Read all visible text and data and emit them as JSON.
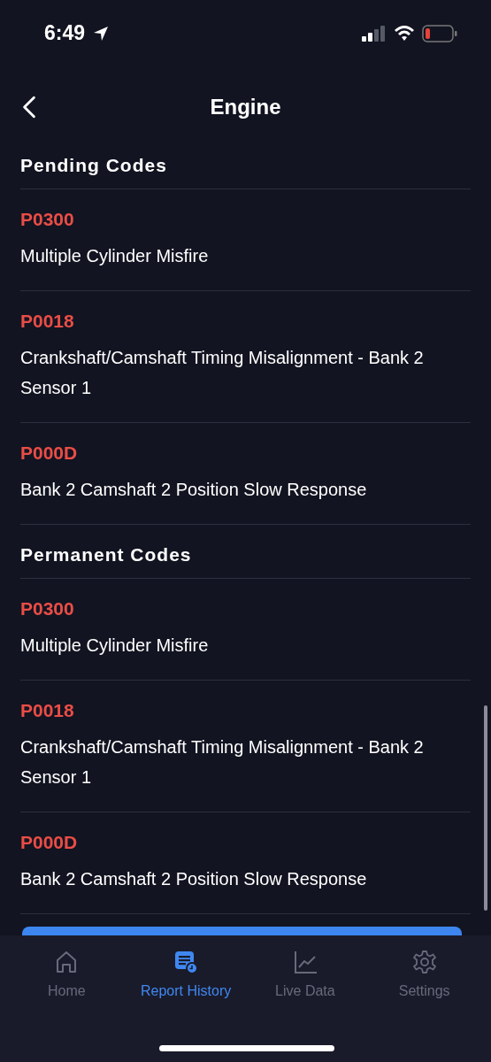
{
  "status_bar": {
    "time": "6:49"
  },
  "header": {
    "title": "Engine"
  },
  "sections": [
    {
      "title": "Pending Codes",
      "codes": [
        {
          "code": "P0300",
          "description": "Multiple Cylinder Misfire"
        },
        {
          "code": "P0018",
          "description": "Crankshaft/Camshaft Timing Misalignment - Bank 2 Sensor 1"
        },
        {
          "code": "P000D",
          "description": "Bank 2 Camshaft 2 Position Slow Response"
        }
      ]
    },
    {
      "title": "Permanent Codes",
      "codes": [
        {
          "code": "P0300",
          "description": "Multiple Cylinder Misfire"
        },
        {
          "code": "P0018",
          "description": "Crankshaft/Camshaft Timing Misalignment - Bank 2 Sensor 1"
        },
        {
          "code": "P000D",
          "description": "Bank 2 Camshaft 2 Position Slow Response"
        }
      ]
    }
  ],
  "tab_bar": [
    {
      "kind": "home",
      "label": "Home",
      "selected": false
    },
    {
      "kind": "report",
      "label": "Report History",
      "selected": true
    },
    {
      "kind": "chart",
      "label": "Live Data",
      "selected": false
    },
    {
      "kind": "settings",
      "label": "Settings",
      "selected": false
    }
  ]
}
